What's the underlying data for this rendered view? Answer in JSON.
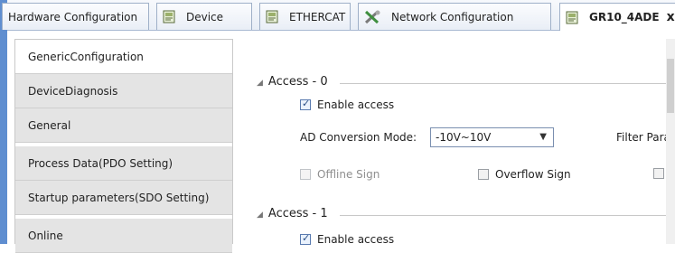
{
  "tabs": [
    {
      "label": "Hardware Configuration"
    },
    {
      "label": "Device",
      "icon": "device-doc-icon"
    },
    {
      "label": "ETHERCAT",
      "icon": "device-doc-icon"
    },
    {
      "label": "Network Configuration",
      "icon": "tools-icon"
    },
    {
      "label": "GR10_4ADE",
      "icon": "device-doc-icon",
      "active": true,
      "close": "x"
    }
  ],
  "sidebar": {
    "items": [
      {
        "label": "GenericConfiguration",
        "active": true
      },
      {
        "label": "DeviceDiagnosis"
      },
      {
        "label": "General"
      },
      {
        "label": "Process Data(PDO Setting)"
      },
      {
        "label": "Startup parameters(SDO Setting)"
      },
      {
        "label": "Online"
      }
    ]
  },
  "main": {
    "group0": {
      "title": "Access - 0",
      "enable_access": "Enable access",
      "ad_label": "AD Conversion Mode:",
      "ad_value": "-10V~10V",
      "filter_label": "Filter Para",
      "offline_sign": "Offline Sign",
      "overflow_sign": "Overflow Sign"
    },
    "group1": {
      "title": "Access - 1",
      "enable_access": "Enable access"
    }
  },
  "colors": {
    "accent": "#5f8ed0",
    "sidebar_bg": "#e4e4e4",
    "select_border": "#7a8fb0"
  }
}
